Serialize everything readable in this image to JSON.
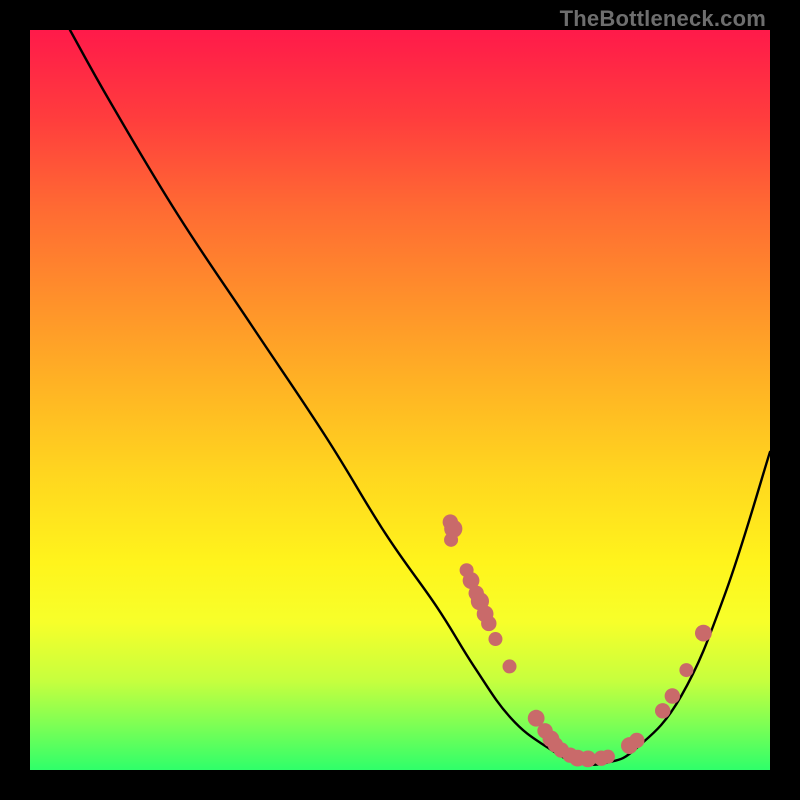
{
  "watermark": "TheBottleneck.com",
  "chart_data": {
    "type": "line",
    "title": "",
    "xlabel": "",
    "ylabel": "",
    "xlim": [
      0,
      100
    ],
    "ylim": [
      0,
      100
    ],
    "curve": [
      {
        "x": 5.4,
        "y": 100
      },
      {
        "x": 11,
        "y": 90
      },
      {
        "x": 20,
        "y": 75
      },
      {
        "x": 30,
        "y": 60
      },
      {
        "x": 40,
        "y": 45
      },
      {
        "x": 48,
        "y": 32
      },
      {
        "x": 55,
        "y": 22
      },
      {
        "x": 60,
        "y": 14
      },
      {
        "x": 65,
        "y": 7
      },
      {
        "x": 70,
        "y": 3
      },
      {
        "x": 74,
        "y": 1
      },
      {
        "x": 78,
        "y": 1
      },
      {
        "x": 82,
        "y": 3
      },
      {
        "x": 88,
        "y": 10
      },
      {
        "x": 94,
        "y": 24
      },
      {
        "x": 100,
        "y": 43
      }
    ],
    "points": [
      {
        "x": 56.8,
        "y": 33.5,
        "r": 1.1
      },
      {
        "x": 57.2,
        "y": 32.6,
        "r": 1.3
      },
      {
        "x": 56.9,
        "y": 31.1,
        "r": 1.0
      },
      {
        "x": 59.0,
        "y": 27.0,
        "r": 1.0
      },
      {
        "x": 59.6,
        "y": 25.6,
        "r": 1.2
      },
      {
        "x": 60.3,
        "y": 23.9,
        "r": 1.1
      },
      {
        "x": 60.8,
        "y": 22.8,
        "r": 1.3
      },
      {
        "x": 61.5,
        "y": 21.1,
        "r": 1.2
      },
      {
        "x": 62.0,
        "y": 19.8,
        "r": 1.1
      },
      {
        "x": 62.9,
        "y": 17.7,
        "r": 1.0
      },
      {
        "x": 64.8,
        "y": 14.0,
        "r": 1.0
      },
      {
        "x": 68.4,
        "y": 7.0,
        "r": 1.2
      },
      {
        "x": 69.6,
        "y": 5.3,
        "r": 1.1
      },
      {
        "x": 70.4,
        "y": 4.2,
        "r": 1.2
      },
      {
        "x": 71.0,
        "y": 3.4,
        "r": 1.1
      },
      {
        "x": 71.8,
        "y": 2.7,
        "r": 1.1
      },
      {
        "x": 73.0,
        "y": 2.0,
        "r": 1.1
      },
      {
        "x": 74.0,
        "y": 1.6,
        "r": 1.2
      },
      {
        "x": 75.4,
        "y": 1.5,
        "r": 1.2
      },
      {
        "x": 77.2,
        "y": 1.6,
        "r": 1.1
      },
      {
        "x": 78.1,
        "y": 1.8,
        "r": 1.0
      },
      {
        "x": 81.0,
        "y": 3.3,
        "r": 1.2
      },
      {
        "x": 82.0,
        "y": 4.0,
        "r": 1.1
      },
      {
        "x": 85.5,
        "y": 8.0,
        "r": 1.1
      },
      {
        "x": 86.8,
        "y": 10.0,
        "r": 1.1
      },
      {
        "x": 88.7,
        "y": 13.5,
        "r": 1.0
      },
      {
        "x": 91.0,
        "y": 18.5,
        "r": 1.2
      }
    ]
  }
}
